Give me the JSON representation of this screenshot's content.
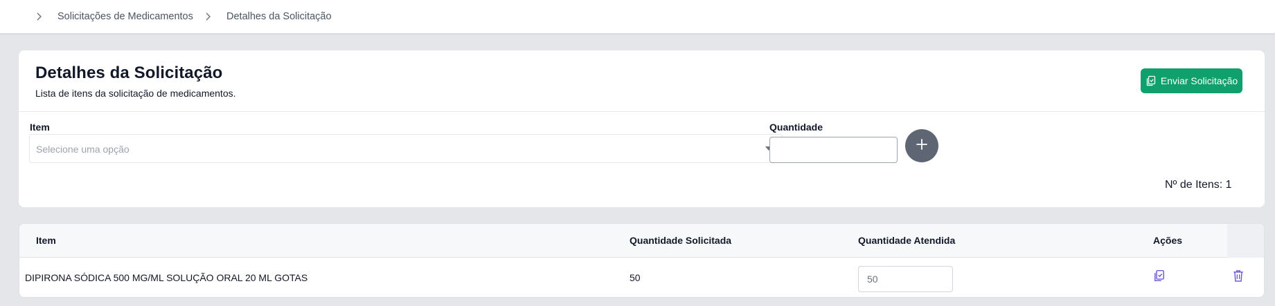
{
  "breadcrumb": {
    "items": [
      "Solicitações de Medicamentos",
      "Detalhes da Solicitação"
    ]
  },
  "header": {
    "title": "Detalhes da Solicitação",
    "subtitle": "Lista de itens da solicitação de medicamentos.",
    "send_button": "Enviar Solicitação"
  },
  "form": {
    "item_label": "Item",
    "item_placeholder": "Selecione uma opção",
    "quantity_label": "Quantidade",
    "quantity_value": ""
  },
  "summary": {
    "item_count": "Nº de Itens: 1"
  },
  "table": {
    "columns": [
      "Item",
      "Quantidade Solicitada",
      "Quantidade Atendida",
      "Ações"
    ],
    "rows": [
      {
        "item": "DIPIRONA SÓDICA 500 MG/ML SOLUÇÃO ORAL 20 ML GOTAS",
        "requested": "50",
        "attended": "50"
      }
    ]
  },
  "colors": {
    "primary_green": "#10a06d",
    "action_icon": "#6b5bd6",
    "add_button": "#5f6673"
  },
  "icons": {
    "breadcrumb_separator": "chevron-right-icon",
    "send": "clipboard-check-icon",
    "add": "plus-icon",
    "copy": "clipboard-check-icon",
    "delete": "trash-icon"
  }
}
